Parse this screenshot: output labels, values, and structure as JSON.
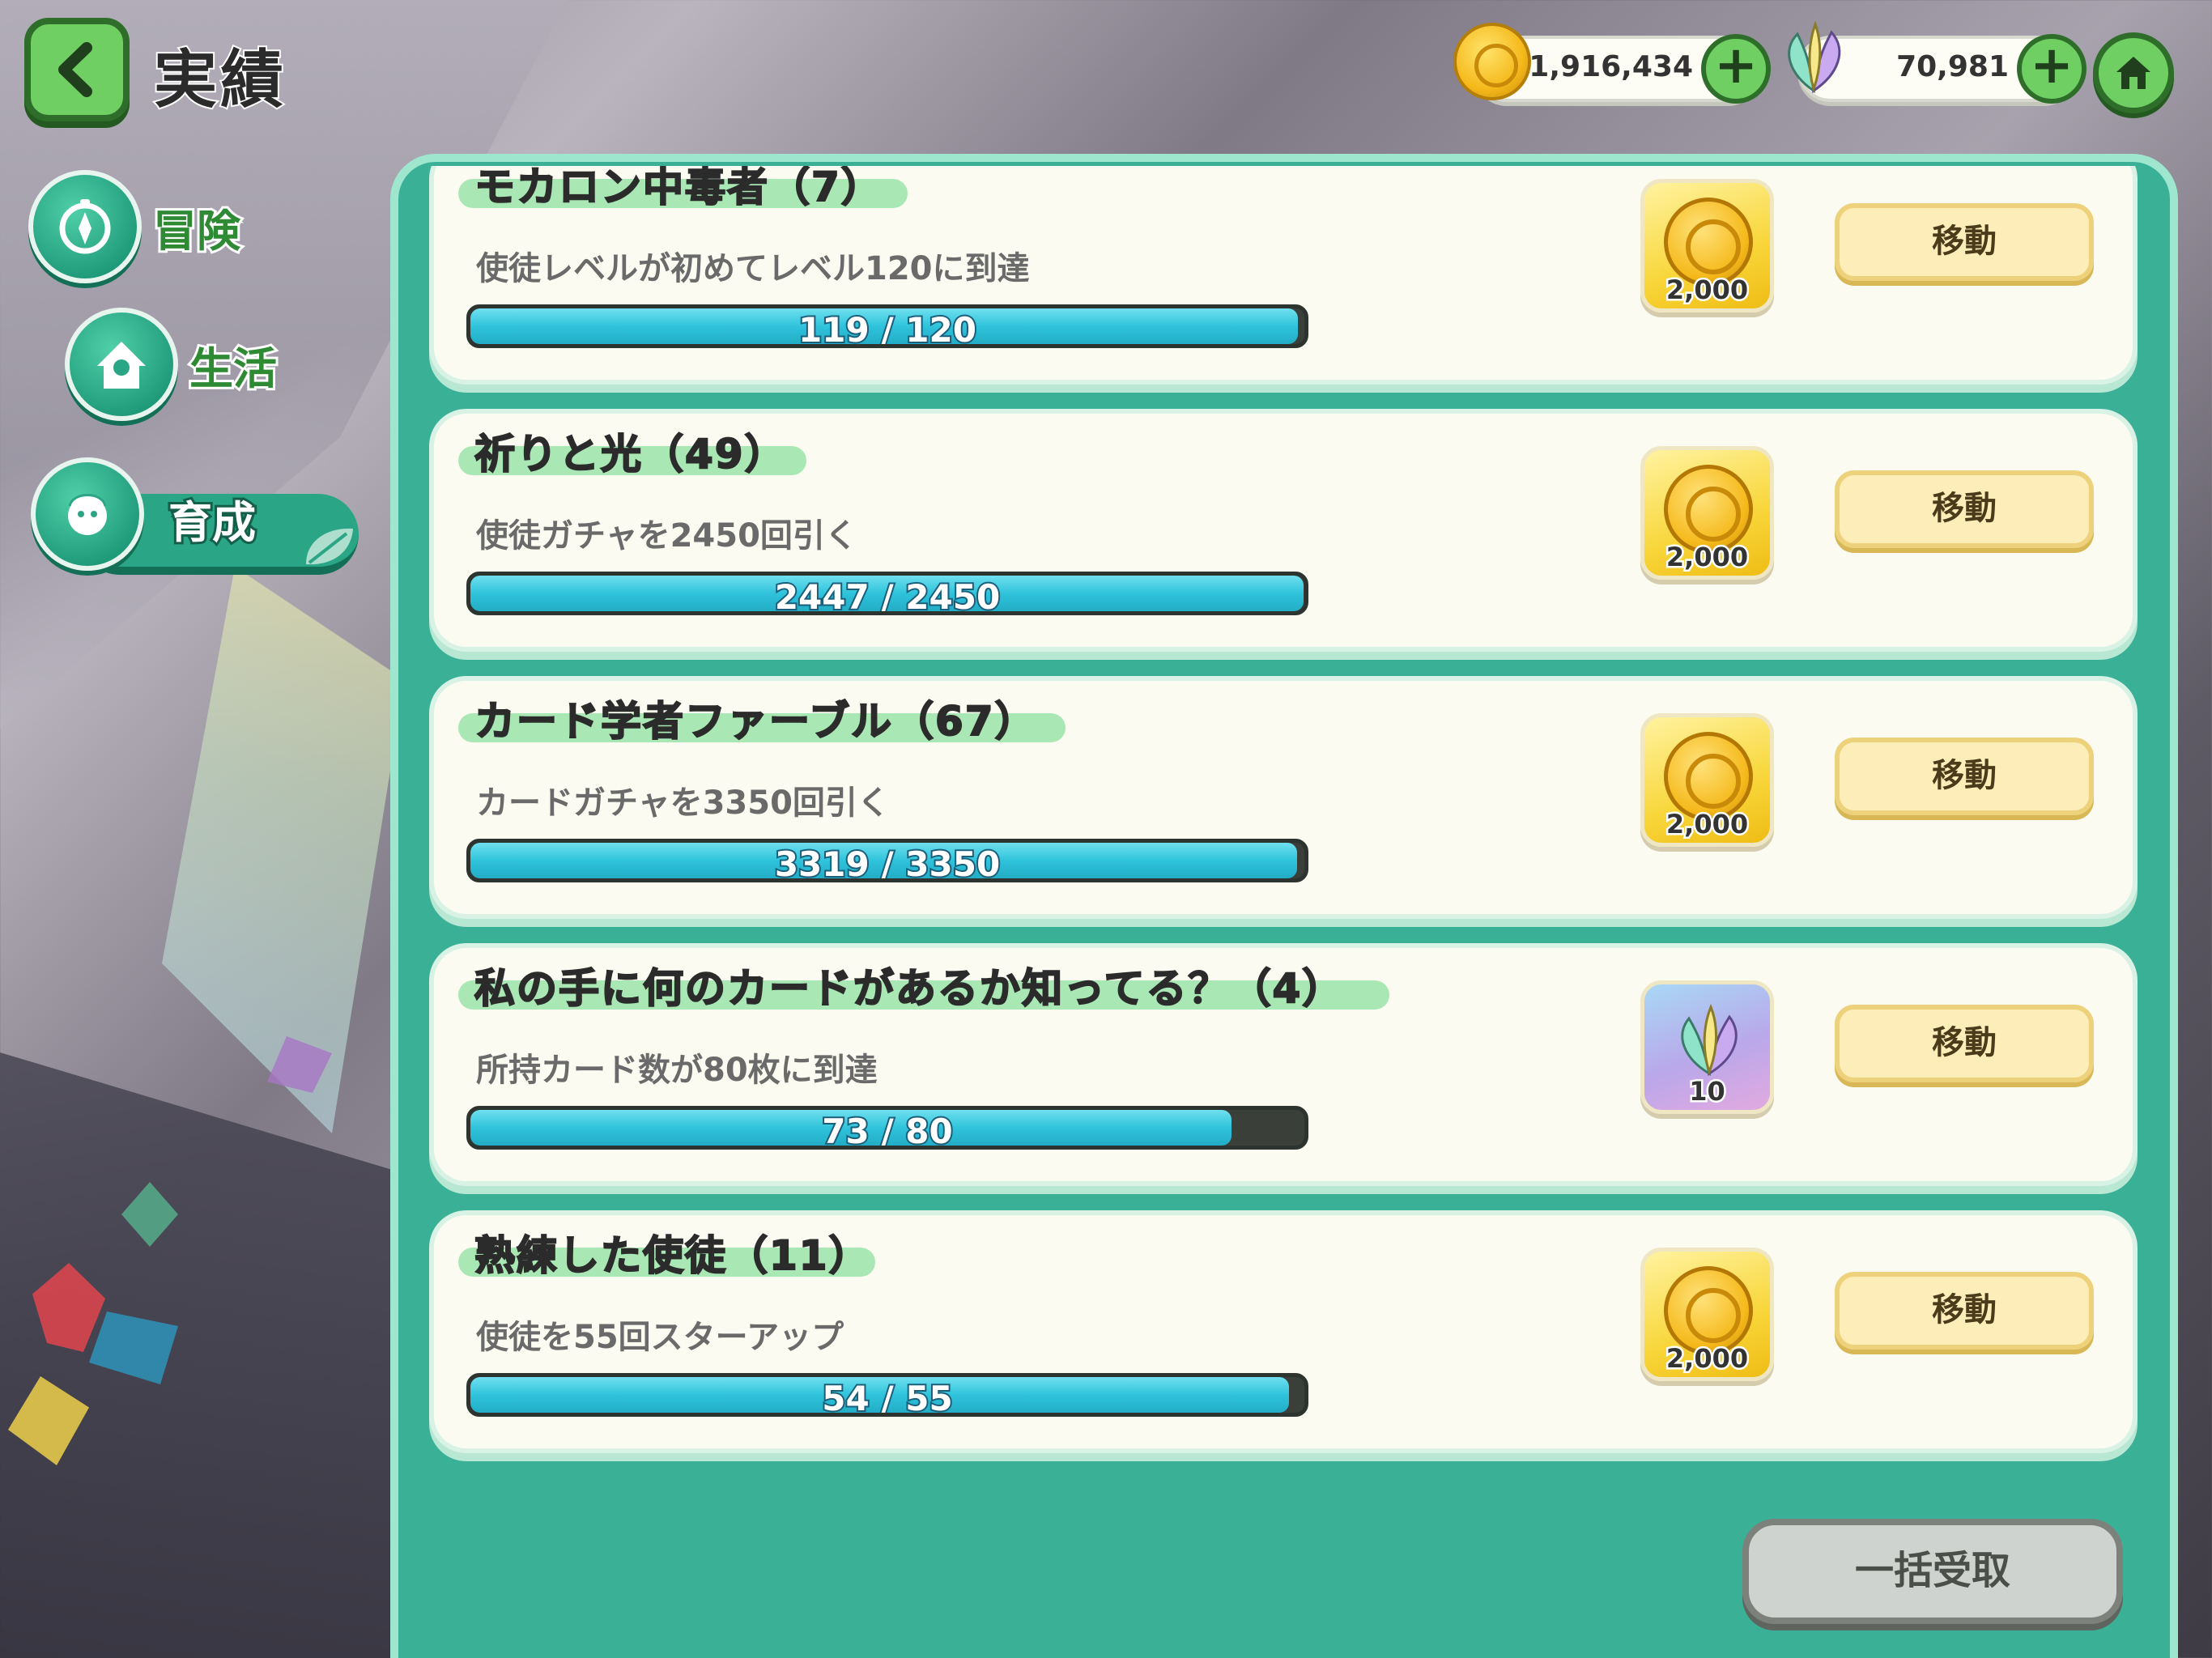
{
  "header": {
    "title": "実績"
  },
  "currency": {
    "coins": "1,916,434",
    "gems": "70,981",
    "plus": "+"
  },
  "sidebar": {
    "items": [
      {
        "label": "冒険"
      },
      {
        "label": "生活"
      },
      {
        "label": "育成",
        "selected": true
      }
    ]
  },
  "achievements": [
    {
      "title": "モカロン中毒者（7）",
      "description": "使徒レベルが初めてレベル120に到達",
      "progress_text": "119 / 120",
      "progress": 0.992,
      "reward_type": "coin",
      "reward_label": "2,000",
      "button": "移動"
    },
    {
      "title": "祈りと光（49）",
      "description": "使徒ガチャを2450回引く",
      "progress_text": "2447 / 2450",
      "progress": 0.999,
      "reward_type": "coin",
      "reward_label": "2,000",
      "button": "移動"
    },
    {
      "title": "カード学者ファーブル（67）",
      "description": "カードガチャを3350回引く",
      "progress_text": "3319 / 3350",
      "progress": 0.991,
      "reward_type": "coin",
      "reward_label": "2,000",
      "button": "移動"
    },
    {
      "title": "私の手に何のカードがあるか知ってる？（4）",
      "description": "所持カード数が80枚に到達",
      "progress_text": "73 / 80",
      "progress": 0.9125,
      "reward_type": "leaf",
      "reward_label": "10",
      "button": "移動"
    },
    {
      "title": "熟練した使徒（11）",
      "description": "使徒を55回スターアップ",
      "progress_text": "54 / 55",
      "progress": 0.982,
      "reward_type": "coin",
      "reward_label": "2,000",
      "button": "移動"
    }
  ],
  "footer": {
    "bulk_label": "一括受取"
  },
  "colors": {
    "accent": "#3ab197",
    "button_green": "#6fcf62",
    "progress_fill": "#2fc3db",
    "move_button": "#fdedb9"
  }
}
